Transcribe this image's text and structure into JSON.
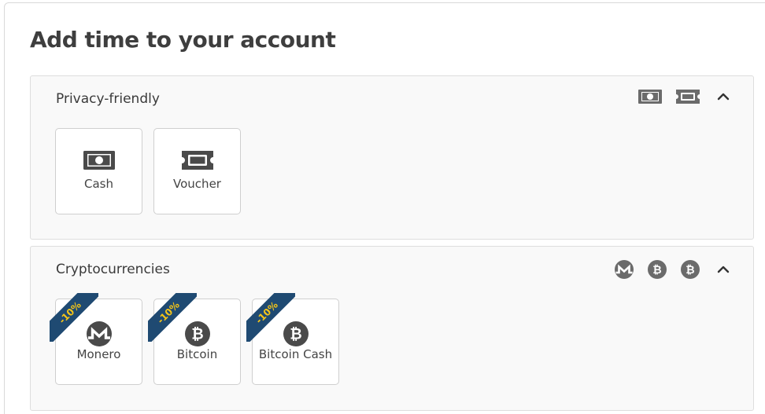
{
  "page": {
    "title": "Add time to your account"
  },
  "sections": [
    {
      "title": "Privacy-friendly",
      "header_icons": [
        "cash-icon",
        "voucher-icon"
      ],
      "options": [
        {
          "label": "Cash",
          "icon": "cash-icon"
        },
        {
          "label": "Voucher",
          "icon": "voucher-icon"
        }
      ]
    },
    {
      "title": "Cryptocurrencies",
      "header_icons": [
        "monero-icon",
        "bitcoin-icon",
        "bitcoin-cash-icon"
      ],
      "options": [
        {
          "label": "Monero",
          "icon": "monero-icon",
          "badge": "-10%"
        },
        {
          "label": "Bitcoin",
          "icon": "bitcoin-icon",
          "badge": "-10%"
        },
        {
          "label": "Bitcoin Cash",
          "icon": "bitcoin-cash-icon",
          "badge": "-10%"
        }
      ]
    }
  ],
  "colors": {
    "ribbon": "#1f4a72",
    "ribbon_text": "#f5c518",
    "icon": "#4a4a4a",
    "header_icon": "#6b6b6b"
  }
}
